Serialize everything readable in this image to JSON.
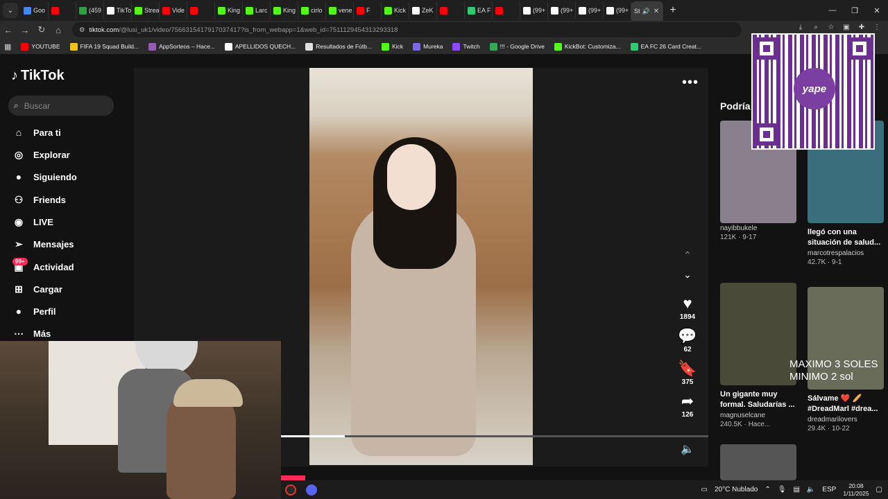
{
  "browser": {
    "tabs": [
      {
        "label": "Goo",
        "icon": "google-icon",
        "color": "#4285f4"
      },
      {
        "label": "",
        "icon": "youtube-icon",
        "color": "#ff0000"
      },
      {
        "label": "(459",
        "icon": "chat-icon",
        "color": "#2ea043"
      },
      {
        "label": "TikTo",
        "icon": "tiktok-icon",
        "color": "#ffffff"
      },
      {
        "label": "Strea",
        "icon": "kick-icon",
        "color": "#53fc18"
      },
      {
        "label": "Vide",
        "icon": "youtube-icon",
        "color": "#ff0000"
      },
      {
        "label": "",
        "icon": "youtube-icon",
        "color": "#ff0000"
      },
      {
        "label": "King",
        "icon": "kick-icon",
        "color": "#53fc18"
      },
      {
        "label": "Larc",
        "icon": "kick-icon",
        "color": "#53fc18"
      },
      {
        "label": "King",
        "icon": "kick-icon",
        "color": "#53fc18"
      },
      {
        "label": "cirlo",
        "icon": "kick-icon",
        "color": "#53fc18"
      },
      {
        "label": "vene",
        "icon": "kick-icon",
        "color": "#53fc18"
      },
      {
        "label": "F",
        "icon": "youtube-icon",
        "color": "#ff0000"
      },
      {
        "label": "Kick",
        "icon": "kick-icon",
        "color": "#53fc18"
      },
      {
        "label": "ZeK",
        "icon": "tiktok-icon",
        "color": "#ffffff"
      },
      {
        "label": "",
        "icon": "youtube-icon",
        "color": "#ff0000"
      },
      {
        "label": "EA F",
        "icon": "ea-icon",
        "color": "#2ecc71"
      },
      {
        "label": "",
        "icon": "youtube-icon",
        "color": "#ff0000"
      },
      {
        "label": "(99+",
        "icon": "tiktok-icon",
        "color": "#ffffff"
      },
      {
        "label": "(99+",
        "icon": "tiktok-icon",
        "color": "#ffffff"
      },
      {
        "label": "(99+",
        "icon": "tiktok-icon",
        "color": "#ffffff"
      },
      {
        "label": "(99+",
        "icon": "tiktok-icon",
        "color": "#ffffff"
      }
    ],
    "active_tab": {
      "label": "St",
      "icon": "speaker-icon"
    },
    "url_main": "tiktok.com",
    "url_rest": "/@lusi_uk1/video/7566315417917037417?is_from_webapp=1&web_id=7511129454313293318",
    "bookmarks": [
      {
        "label": "YOUTUBE",
        "color": "#ff0000"
      },
      {
        "label": "FIFA 19 Squad Build...",
        "color": "#f1c40f"
      },
      {
        "label": "AppSorteos – Hace...",
        "color": "#9b59b6"
      },
      {
        "label": "APELLIDOS QUECH...",
        "color": "#ffffff"
      },
      {
        "label": "Resultados de Fútb...",
        "color": "#e0e0e0"
      },
      {
        "label": "Kick",
        "color": "#53fc18"
      },
      {
        "label": "Mureka",
        "color": "#7b68ee"
      },
      {
        "label": "Twitch",
        "color": "#9146ff"
      },
      {
        "label": "!!! - Google Drive",
        "color": "#34a853"
      },
      {
        "label": "KickBot: Customiza...",
        "color": "#53fc18"
      },
      {
        "label": "EA FC 26 Card Creat...",
        "color": "#2ecc71"
      }
    ]
  },
  "tiktok": {
    "logo": "TikTok",
    "search_placeholder": "Buscar",
    "nav": [
      {
        "label": "Para ti",
        "icon": "home-icon"
      },
      {
        "label": "Explorar",
        "icon": "compass-icon"
      },
      {
        "label": "Siguiendo",
        "icon": "following-avatar-icon"
      },
      {
        "label": "Friends",
        "icon": "friends-icon"
      },
      {
        "label": "LIVE",
        "icon": "live-icon"
      },
      {
        "label": "Mensajes",
        "icon": "send-icon"
      },
      {
        "label": "Actividad",
        "icon": "inbox-icon"
      },
      {
        "label": "Cargar",
        "icon": "upload-icon"
      },
      {
        "label": "Perfil",
        "icon": "profile-avatar-icon"
      },
      {
        "label": "Más",
        "icon": "more-icon"
      }
    ],
    "activity_badge": "99+",
    "actions": {
      "likes": "1894",
      "comments": "62",
      "saves": "375",
      "shares": "126"
    },
    "progress_fraction": 0.15,
    "recs_title": "Podría",
    "cards": [
      {
        "text": "",
        "user": "nayibbukele",
        "meta": "121K · 9-17",
        "color": "#8a7f8c"
      },
      {
        "text": "llegó con una situación de salud...",
        "user": "marcotrespalacios",
        "meta": "42.7K · 9-1",
        "color": "#3a6e7c"
      },
      {
        "text": "Un gigante muy formal. Saludarías ...",
        "user": "magnuselcane",
        "meta": "240.5K · Hace...",
        "color": "#4a4a38"
      },
      {
        "text": "Sálvame ❤️ 🥖 #DreadMarl #drea...",
        "user": "dreadmarilovers",
        "meta": "29.4K · 10-22",
        "color": "#6a6c5a"
      }
    ]
  },
  "overlay": {
    "line1": "MAXIMO 3 SOLES",
    "line2": "MINIMO 2 sol",
    "qr_label": "yape"
  },
  "taskbar": {
    "weather": "20°C  Nublado",
    "lang": "ESP",
    "time": "20:08",
    "date": "1/11/2025"
  }
}
